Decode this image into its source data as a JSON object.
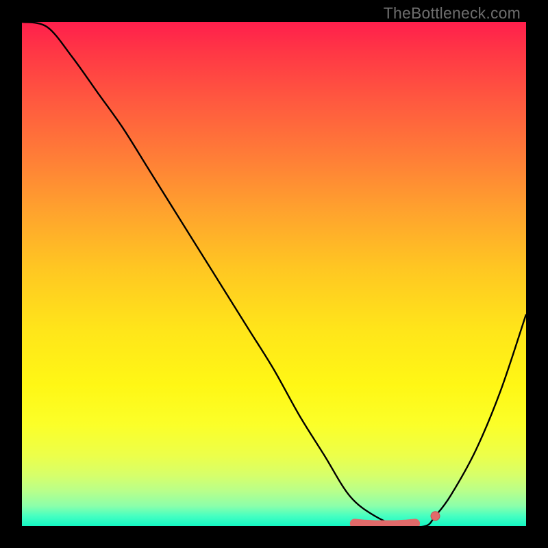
{
  "watermark": "TheBottleneck.com",
  "colors": {
    "frame": "#000000",
    "curve": "#000000",
    "marker": "#e16a6a",
    "marker_stroke": "#c94f55"
  },
  "chart_data": {
    "type": "line",
    "title": "",
    "xlabel": "",
    "ylabel": "",
    "xlim": [
      0,
      100
    ],
    "ylim": [
      0,
      100
    ],
    "series": [
      {
        "name": "bottleneck-curve",
        "x": [
          0,
          5,
          10,
          15,
          20,
          25,
          30,
          35,
          40,
          45,
          50,
          55,
          60,
          65,
          70,
          75,
          80,
          82,
          85,
          90,
          95,
          100
        ],
        "y": [
          100,
          99,
          93,
          86,
          79,
          71,
          63,
          55,
          47,
          39,
          31,
          22,
          14,
          6,
          2,
          0,
          0,
          2,
          6,
          15,
          27,
          42
        ]
      }
    ],
    "markers": {
      "name": "sweet-spot",
      "x": [
        66,
        68,
        70,
        72,
        74,
        76,
        78,
        82
      ],
      "y": [
        0.5,
        0.3,
        0.2,
        0.2,
        0.2,
        0.3,
        0.5,
        2
      ]
    },
    "gradient_hint": "vertical rainbow red→yellow→green, y maps to goodness (bottom = good / green, top = bad / red)"
  }
}
